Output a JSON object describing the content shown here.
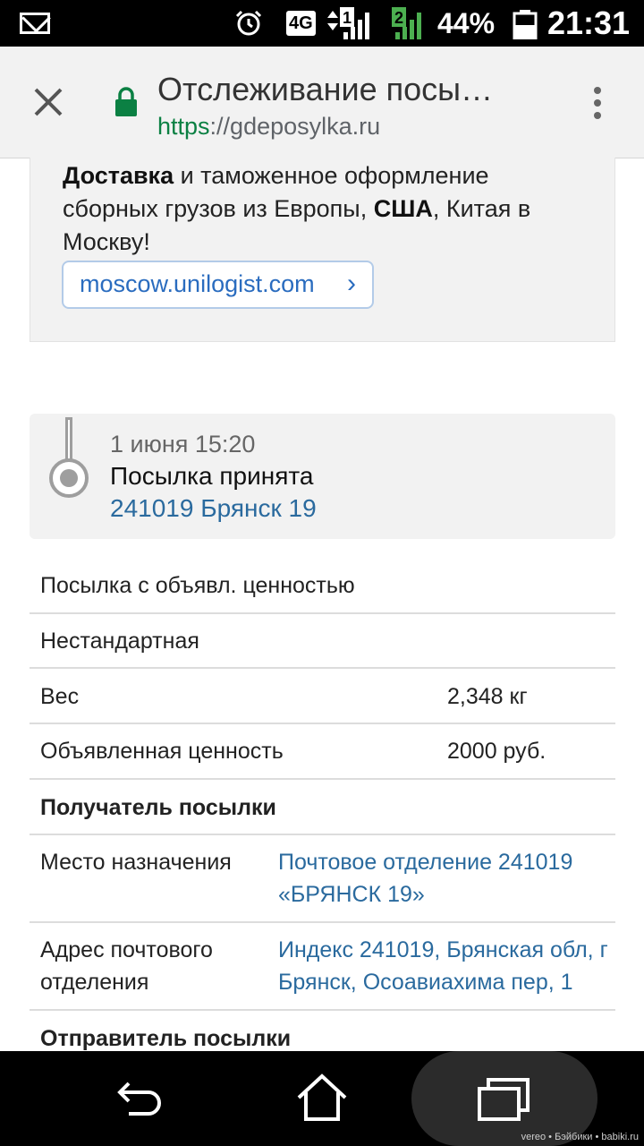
{
  "status_bar": {
    "network": "4G",
    "sim1_badge": "1",
    "sim2_badge": "2",
    "battery": "44%",
    "time": "21:31"
  },
  "browser": {
    "title": "Отслеживание посы…",
    "url_scheme": "https",
    "url_rest": "://gdeposylka.ru"
  },
  "ad": {
    "bold1": "Доставка",
    "text1": " и таможенное оформление сборных грузов из Европы, ",
    "bold2": "США",
    "text2": ", Китая в Москву!",
    "link": "moscow.unilogist.com"
  },
  "event": {
    "date": "1 июня 15:20",
    "status": "Посылка принята",
    "place": "241019 Брянск 19"
  },
  "info": {
    "type": "Посылка с объявл. ценностью",
    "category": "Нестандартная",
    "weight_label": "Вес",
    "weight_value": "2,348 кг",
    "value_label": "Объявленная ценность",
    "value_value": "2000 руб.",
    "recipient_heading": "Получатель посылки",
    "destination_label": "Место назначения",
    "destination_value": "Почтовое отделение 241019 «БРЯНСК 19»",
    "address_label": "Адрес почтового отделения",
    "address_value": "Индекс 241019, Брянская обл, г Брянск, Осоавиахима пер, 1",
    "sender_heading": "Отправитель посылки"
  },
  "watermark": "vereo • Бэйбики • babiki.ru"
}
